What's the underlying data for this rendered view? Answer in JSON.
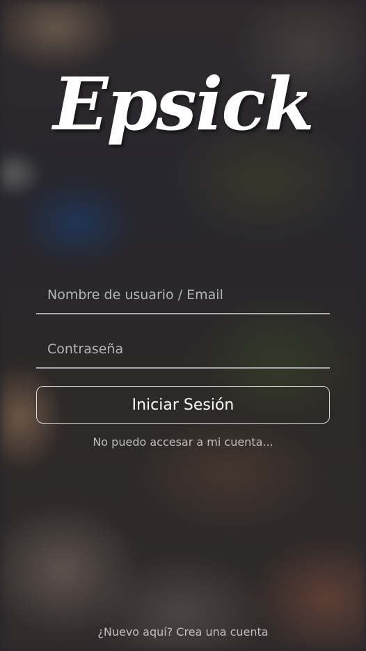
{
  "brand": {
    "logo_text": "Epsick"
  },
  "login_form": {
    "username_placeholder": "Nombre de usuario / Email",
    "username_value": "",
    "password_placeholder": "Contraseña",
    "password_value": "",
    "submit_label": "Iniciar Sesión",
    "forgot_link": "No puedo accesar a mi cuenta..."
  },
  "footer": {
    "signup_link": "¿Nuevo aquí? Crea una cuenta"
  }
}
